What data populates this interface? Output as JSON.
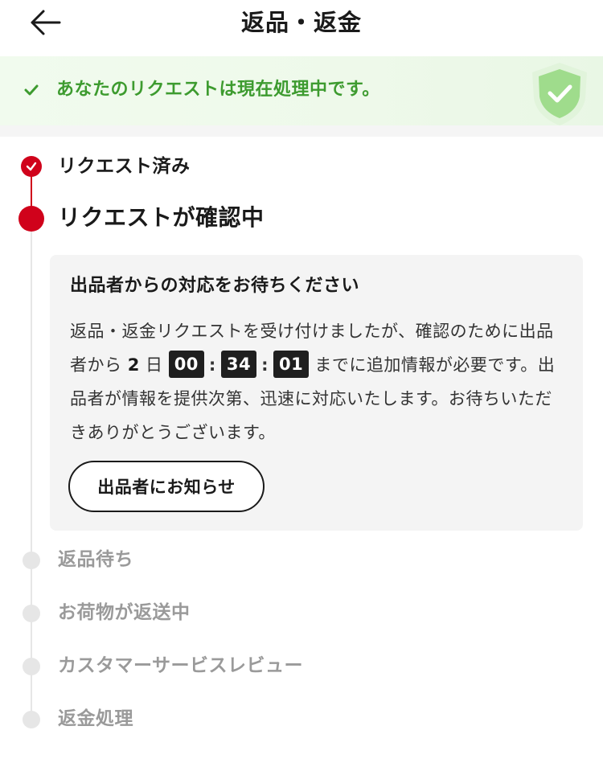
{
  "header": {
    "title": "返品・返金"
  },
  "status_banner": {
    "text": "あなたのリクエストは現在処理中です。"
  },
  "timeline": {
    "steps": [
      {
        "label": "リクエスト済み",
        "state": "done"
      },
      {
        "label": "リクエストが確認中",
        "state": "current"
      },
      {
        "label": "返品待ち",
        "state": "pending"
      },
      {
        "label": "お荷物が返送中",
        "state": "pending"
      },
      {
        "label": "カスタマーサービスレビュー",
        "state": "pending"
      },
      {
        "label": "返金処理",
        "state": "pending"
      }
    ]
  },
  "info_card": {
    "title": "出品者からの対応をお待ちください",
    "body_before": "返品・返金リクエストを受け付けましたが、確認のために出品者から",
    "countdown": {
      "days": "2",
      "day_unit": "日",
      "hours": "00",
      "minutes": "34",
      "seconds": "01"
    },
    "body_after": "までに追加情報が必要です。出品者が情報を提供次第、迅速に対応いたします。お待ちいただきありがとうございます。",
    "button_label": "出品者にお知らせ"
  },
  "colors": {
    "accent_red": "#d0021b",
    "success_green": "#3d9b2f",
    "pending_grey": "#9a9a9a"
  }
}
